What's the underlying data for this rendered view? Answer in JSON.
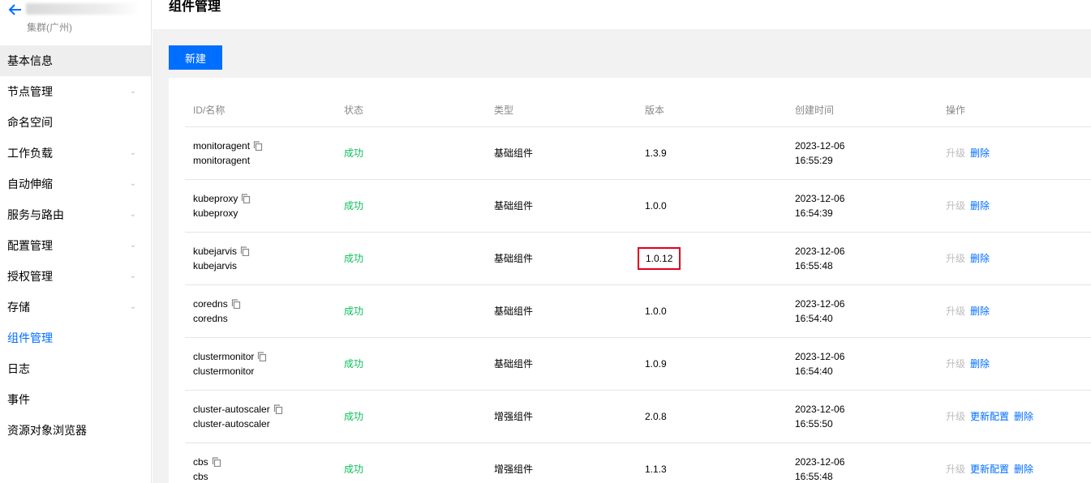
{
  "sidebar": {
    "cluster_sub": "集群(广州)",
    "items": [
      {
        "label": "基本信息",
        "chevron": false,
        "active": true,
        "current": false
      },
      {
        "label": "节点管理",
        "chevron": true,
        "active": false,
        "current": false
      },
      {
        "label": "命名空间",
        "chevron": false,
        "active": false,
        "current": false
      },
      {
        "label": "工作负载",
        "chevron": true,
        "active": false,
        "current": false
      },
      {
        "label": "自动伸缩",
        "chevron": true,
        "active": false,
        "current": false
      },
      {
        "label": "服务与路由",
        "chevron": true,
        "active": false,
        "current": false
      },
      {
        "label": "配置管理",
        "chevron": true,
        "active": false,
        "current": false
      },
      {
        "label": "授权管理",
        "chevron": true,
        "active": false,
        "current": false
      },
      {
        "label": "存储",
        "chevron": true,
        "active": false,
        "current": false
      },
      {
        "label": "组件管理",
        "chevron": false,
        "active": false,
        "current": true
      },
      {
        "label": "日志",
        "chevron": false,
        "active": false,
        "current": false
      },
      {
        "label": "事件",
        "chevron": false,
        "active": false,
        "current": false
      },
      {
        "label": "资源对象浏览器",
        "chevron": false,
        "active": false,
        "current": false
      }
    ]
  },
  "header": {
    "title": "组件管理"
  },
  "toolbar": {
    "new_label": "新建"
  },
  "table": {
    "headers": {
      "id": "ID/名称",
      "status": "状态",
      "type": "类型",
      "version": "版本",
      "created": "创建时间",
      "ops": "操作"
    },
    "rows": [
      {
        "id": "monitoragent",
        "name": "monitoragent",
        "status": "成功",
        "type": "基础组件",
        "version": "1.3.9",
        "date": "2023-12-06",
        "time": "16:55:29",
        "ops": [
          "升级",
          "删除"
        ]
      },
      {
        "id": "kubeproxy",
        "name": "kubeproxy",
        "status": "成功",
        "type": "基础组件",
        "version": "1.0.0",
        "date": "2023-12-06",
        "time": "16:54:39",
        "ops": [
          "升级",
          "删除"
        ]
      },
      {
        "id": "kubejarvis",
        "name": "kubejarvis",
        "status": "成功",
        "type": "基础组件",
        "version": "1.0.12",
        "highlight": true,
        "date": "2023-12-06",
        "time": "16:55:48",
        "ops": [
          "升级",
          "删除"
        ]
      },
      {
        "id": "coredns",
        "name": "coredns",
        "status": "成功",
        "type": "基础组件",
        "version": "1.0.0",
        "date": "2023-12-06",
        "time": "16:54:40",
        "ops": [
          "升级",
          "删除"
        ]
      },
      {
        "id": "clustermonitor",
        "name": "clustermonitor",
        "status": "成功",
        "type": "基础组件",
        "version": "1.0.9",
        "date": "2023-12-06",
        "time": "16:54:40",
        "ops": [
          "升级",
          "删除"
        ]
      },
      {
        "id": "cluster-autoscaler",
        "name": "cluster-autoscaler",
        "status": "成功",
        "type": "增强组件",
        "version": "2.0.8",
        "date": "2023-12-06",
        "time": "16:55:50",
        "ops": [
          "升级",
          "更新配置",
          "删除"
        ]
      },
      {
        "id": "cbs",
        "name": "cbs",
        "status": "成功",
        "type": "增强组件",
        "version": "1.1.3",
        "date": "2023-12-06",
        "time": "16:55:48",
        "ops": [
          "升级",
          "更新配置",
          "删除"
        ]
      }
    ]
  },
  "colors": {
    "primary": "#006eff",
    "success": "#0abf5b",
    "highlight": "#e1001f"
  }
}
